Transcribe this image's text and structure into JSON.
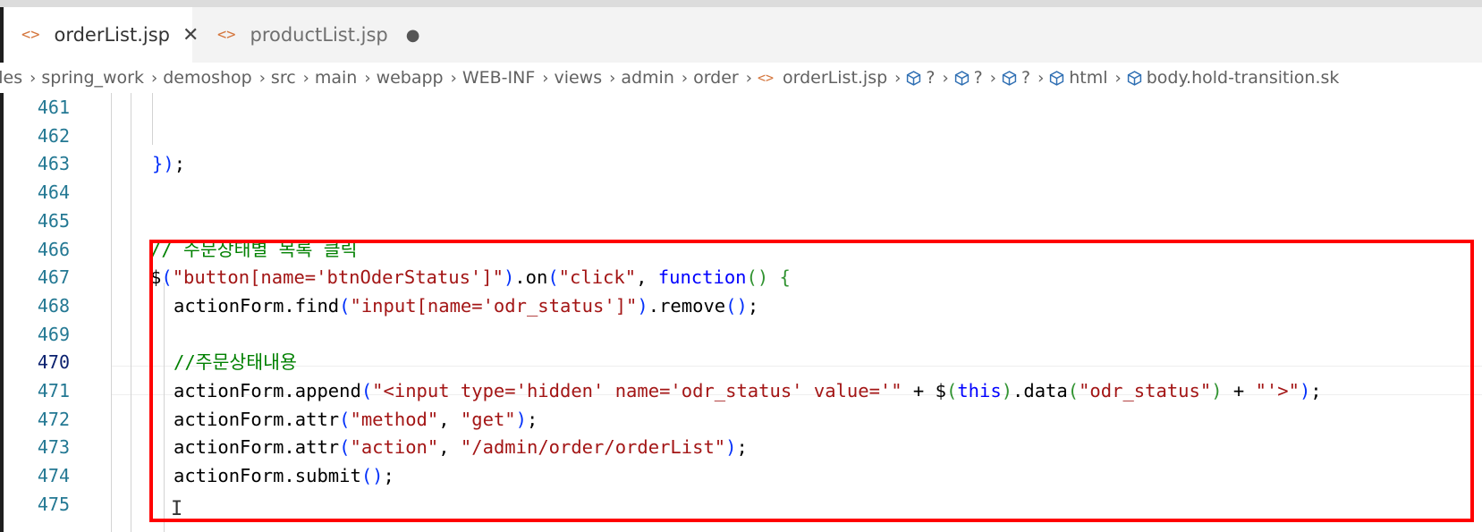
{
  "tabs": [
    {
      "label": "orderList.jsp",
      "icon": "code-file-icon",
      "active": true,
      "close": "✕"
    },
    {
      "label": "productList.jsp",
      "icon": "code-file-icon",
      "active": false,
      "modified": "●"
    }
  ],
  "breadcrumb": [
    "iles",
    "spring_work",
    "demoshop",
    "src",
    "main",
    "webapp",
    "WEB-INF",
    "views",
    "admin",
    "order",
    "orderList.jsp",
    "?",
    "?",
    "?",
    "html",
    "body.hold-transition.sk"
  ],
  "editor": {
    "current_line": 470,
    "lines": [
      {
        "num": "461",
        "text": ""
      },
      {
        "num": "462",
        "text": ""
      },
      {
        "num": "463",
        "text": "});"
      },
      {
        "num": "464",
        "text": ""
      },
      {
        "num": "465",
        "text": ""
      },
      {
        "num": "466",
        "text": "// 주문상태별 목록 클릭"
      },
      {
        "num": "467",
        "text": "$(\"button[name='btnOderStatus']\").on(\"click\", function() {"
      },
      {
        "num": "468",
        "text": "actionForm.find(\"input[name='odr_status']\").remove();"
      },
      {
        "num": "469",
        "text": ""
      },
      {
        "num": "470",
        "text": "//주문상태내용"
      },
      {
        "num": "471",
        "text": "actionForm.append(\"<input type='hidden' name='odr_status' value='\" + $(this).data(\"odr_status\") + \"'>\");"
      },
      {
        "num": "472",
        "text": "actionForm.attr(\"method\", \"get\");"
      },
      {
        "num": "473",
        "text": "actionForm.attr(\"action\", \"/admin/order/orderList\");"
      },
      {
        "num": "474",
        "text": "actionForm.submit();"
      },
      {
        "num": "475",
        "text": ""
      }
    ]
  },
  "colors": {
    "highlight_box": "#ff0000",
    "comment": "#008000",
    "string": "#a31515",
    "keyword": "#0000ff",
    "line_number": "#237893"
  }
}
